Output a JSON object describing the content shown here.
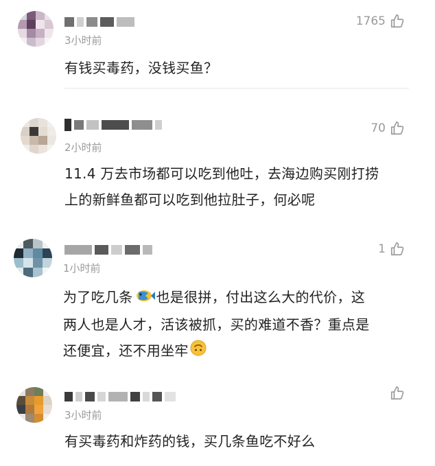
{
  "comments": [
    {
      "time": "3小时前",
      "likes": "1765",
      "text": "有钱买毒药，没钱买鱼？"
    },
    {
      "time": "2小时前",
      "likes": "70",
      "text_lines": [
        "11.4 万去市场都可以吃到他吐，去海边购买刚打捞",
        "上的新鲜鱼都可以吃到他拉肚子，何必呢"
      ]
    },
    {
      "time": "1小时前",
      "likes": "1",
      "line1_before": "为了吃几条",
      "line1_after": "也是很拼，付出这么大的代价，这",
      "line2": "两人也是人才，活该被抓，买的难道不香？重点是",
      "line3": "还便宜，还不用坐牢",
      "fish_emoji": "fish-emoji",
      "smile_emoji": "upside-down-face-emoji"
    },
    {
      "time": "3小时前",
      "likes": "",
      "text": "有买毒药和炸药的钱，买几条鱼吃不好么"
    }
  ],
  "icons": {
    "like": "thumbs-up-outline-icon"
  },
  "colors": {
    "text": "#222222",
    "meta": "#9a9a9a",
    "divider": "#e6e6e6"
  }
}
